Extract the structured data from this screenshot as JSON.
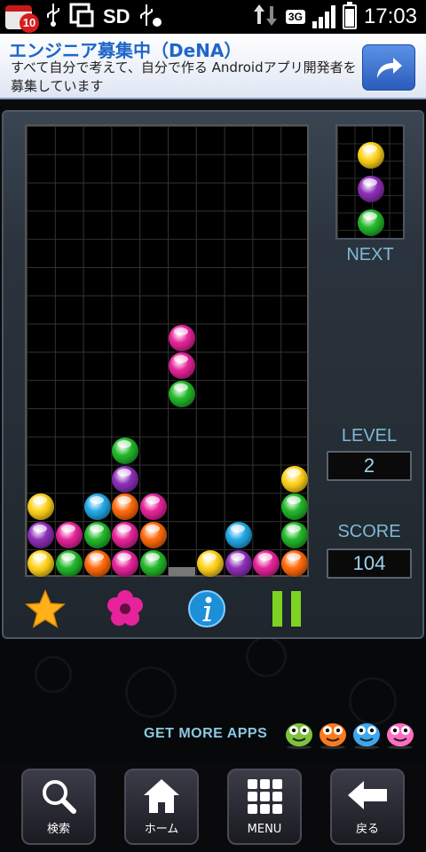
{
  "status_bar": {
    "notification_count": "10",
    "sd_label": "SD",
    "network_label": "3G",
    "clock": "17:03"
  },
  "ad": {
    "title": "エンジニア募集中（DeNA）",
    "body": "すべて自分で考えて、自分で作る Androidアプリ開発者を募集しています",
    "share_icon": "share-arrow-icon"
  },
  "game": {
    "next_label": "NEXT",
    "level_label": "LEVEL",
    "level_value": "2",
    "score_label": "SCORE",
    "score_value": "104",
    "colors": {
      "yellow": "#ffd21a",
      "purple": "#8d2fb8",
      "green": "#22b82a",
      "magenta": "#e6239a",
      "orange": "#ff6a0c",
      "cyan": "#22a8e6"
    },
    "next_pieces": [
      "yellow",
      "purple",
      "green"
    ],
    "falling_piece": {
      "column": 6,
      "top_row": 7,
      "colors": [
        "magenta",
        "magenta",
        "green"
      ]
    },
    "board": {
      "columns": 10,
      "rows": 16,
      "stacks": [
        [
          "yellow",
          "purple",
          "yellow"
        ],
        [
          "green",
          "magenta"
        ],
        [
          "orange",
          "green",
          "cyan"
        ],
        [
          "magenta",
          "magenta",
          "orange",
          "purple",
          "green"
        ],
        [
          "green",
          "orange",
          "magenta"
        ],
        [],
        [
          "yellow"
        ],
        [
          "purple",
          "cyan"
        ],
        [
          "magenta"
        ],
        [
          "orange",
          "green",
          "green",
          "yellow"
        ]
      ]
    },
    "controls": [
      "star-icon",
      "flower-icon",
      "info-icon",
      "pause-icon"
    ]
  },
  "promo": {
    "get_more_label": "GET MORE APPS",
    "monster_colors": [
      "#7ec43a",
      "#ff7a1a",
      "#3aa8f0",
      "#ff6ec0"
    ]
  },
  "nav": {
    "search_label": "検索",
    "home_label": "ホーム",
    "menu_label": "MENU",
    "back_label": "戻る"
  }
}
